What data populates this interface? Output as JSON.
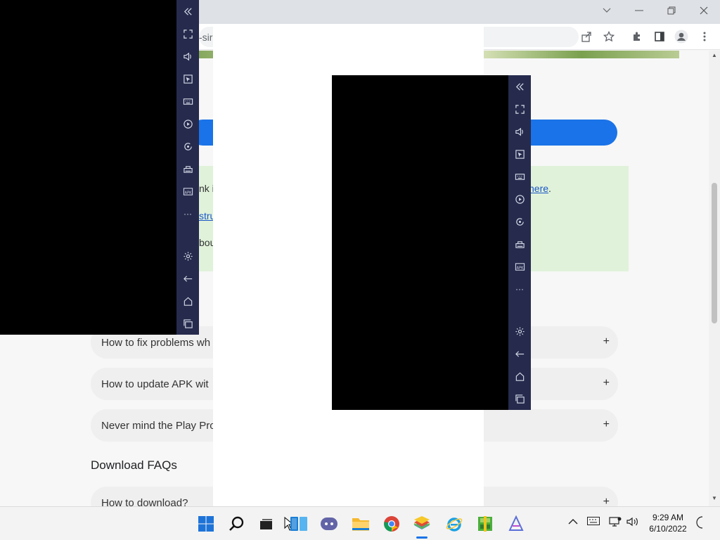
{
  "browser": {
    "url_fragment": "-sir",
    "window_controls": [
      "chevron-down-icon",
      "minimize-icon",
      "restore-icon",
      "close-icon"
    ],
    "toolbar_icons": [
      "share-icon",
      "star-icon",
      "puzzle-icon",
      "sidepanel-icon",
      "profile-icon",
      "menu-dots-icon"
    ]
  },
  "page": {
    "green_box": {
      "line1_prefix": "nk i",
      "line1_link": "here",
      "line1_suffix": ".",
      "line2_link": "stru",
      "line3": "bou"
    },
    "faqs": [
      {
        "label": "How to fix problems wh",
        "icon": "+"
      },
      {
        "label": "How to update APK wit",
        "icon": "+"
      },
      {
        "label": "Never mind the Play Pro",
        "icon": "+"
      }
    ],
    "download_title": "Download FAQs",
    "download_faqs": [
      {
        "label": "How to download?",
        "icon": "+"
      }
    ]
  },
  "emulator_sidebar": {
    "items": [
      "collapse-icon",
      "fullscreen-icon",
      "volume-icon",
      "pointer-icon",
      "keyboard-icon",
      "macro-icon",
      "rotate-icon",
      "multi-instance-icon",
      "apk-icon",
      "more-icon",
      "settings-icon",
      "back-icon",
      "home-icon",
      "recents-icon"
    ],
    "apk_label": "APK",
    "more_label": "···"
  },
  "taskbar": {
    "apps": [
      "windows-start-icon",
      "search-icon",
      "task-view-icon",
      "widgets-icon",
      "chat-icon",
      "file-explorer-icon",
      "chrome-icon",
      "bluestacks-icon",
      "internet-explorer-icon",
      "winrar-icon",
      "app-icon"
    ],
    "clock": {
      "time": "9:29 AM",
      "date": "6/10/2022"
    },
    "tray": [
      "chevron-up-icon",
      "keyboard-icon",
      "network-icon",
      "speaker-icon",
      "night-icon"
    ]
  }
}
